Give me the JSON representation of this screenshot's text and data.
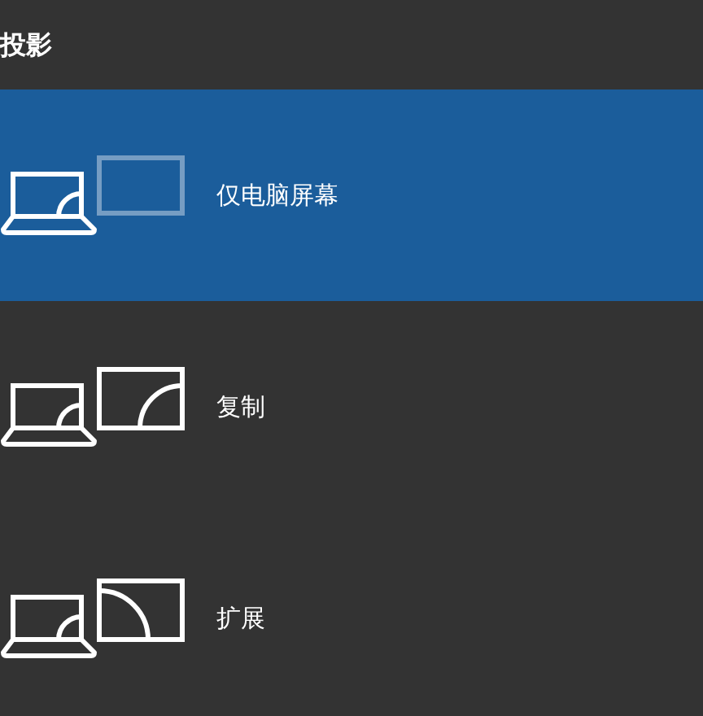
{
  "title": "投影",
  "options": [
    {
      "kind": "pc_only",
      "label": "仅电脑屏幕",
      "selected": true
    },
    {
      "kind": "duplicate",
      "label": "复制",
      "selected": false
    },
    {
      "kind": "extend",
      "label": "扩展",
      "selected": false
    }
  ]
}
